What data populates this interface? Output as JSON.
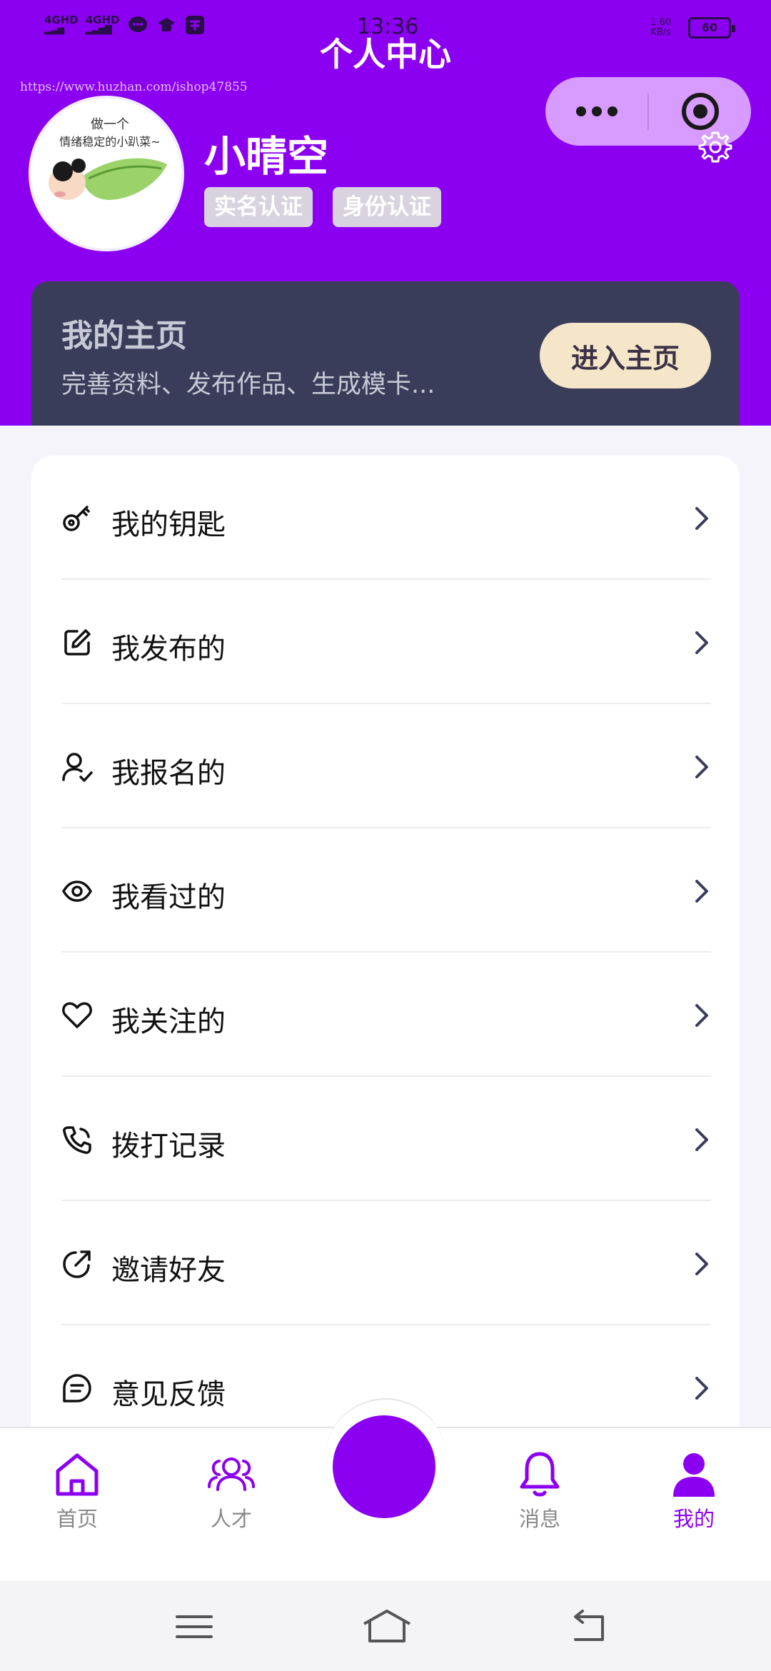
{
  "status_bar": {
    "signal_1": "4GHD",
    "signal_2": "4GHD",
    "time": "13:36",
    "net_speed": "1.60",
    "net_unit": "KB/s",
    "battery": "60"
  },
  "header": {
    "title": "个人中心",
    "watermark": "https://www.huzhan.com/ishop47855"
  },
  "profile": {
    "username": "小晴空",
    "avatar_caption_1": "做一个",
    "avatar_caption_2": "情绪稳定的小趴菜~",
    "badges": [
      "实名认证",
      "身份认证"
    ]
  },
  "homepage_card": {
    "title": "我的主页",
    "subtitle": "完善资料、发布作品、生成模卡...",
    "button": "进入主页"
  },
  "menu": {
    "items": [
      {
        "label": "我的钥匙",
        "icon": "key-icon"
      },
      {
        "label": "我发布的",
        "icon": "edit-icon"
      },
      {
        "label": "我报名的",
        "icon": "user-check-icon"
      },
      {
        "label": "我看过的",
        "icon": "eye-icon"
      },
      {
        "label": "我关注的",
        "icon": "heart-icon"
      },
      {
        "label": "拨打记录",
        "icon": "phone-icon"
      },
      {
        "label": "邀请好友",
        "icon": "share-icon"
      },
      {
        "label": "意见反馈",
        "icon": "feedback-icon"
      }
    ]
  },
  "tabbar": {
    "items": [
      {
        "label": "首页",
        "icon": "home-icon"
      },
      {
        "label": "人才",
        "icon": "people-icon"
      },
      {
        "label": "消息",
        "icon": "bell-icon"
      },
      {
        "label": "我的",
        "icon": "user-icon"
      }
    ]
  },
  "colors": {
    "accent": "#8c00f2",
    "card_dark": "#3a3d5a",
    "button_cream": "#f6e6c9",
    "capsule": "#d89bff"
  }
}
